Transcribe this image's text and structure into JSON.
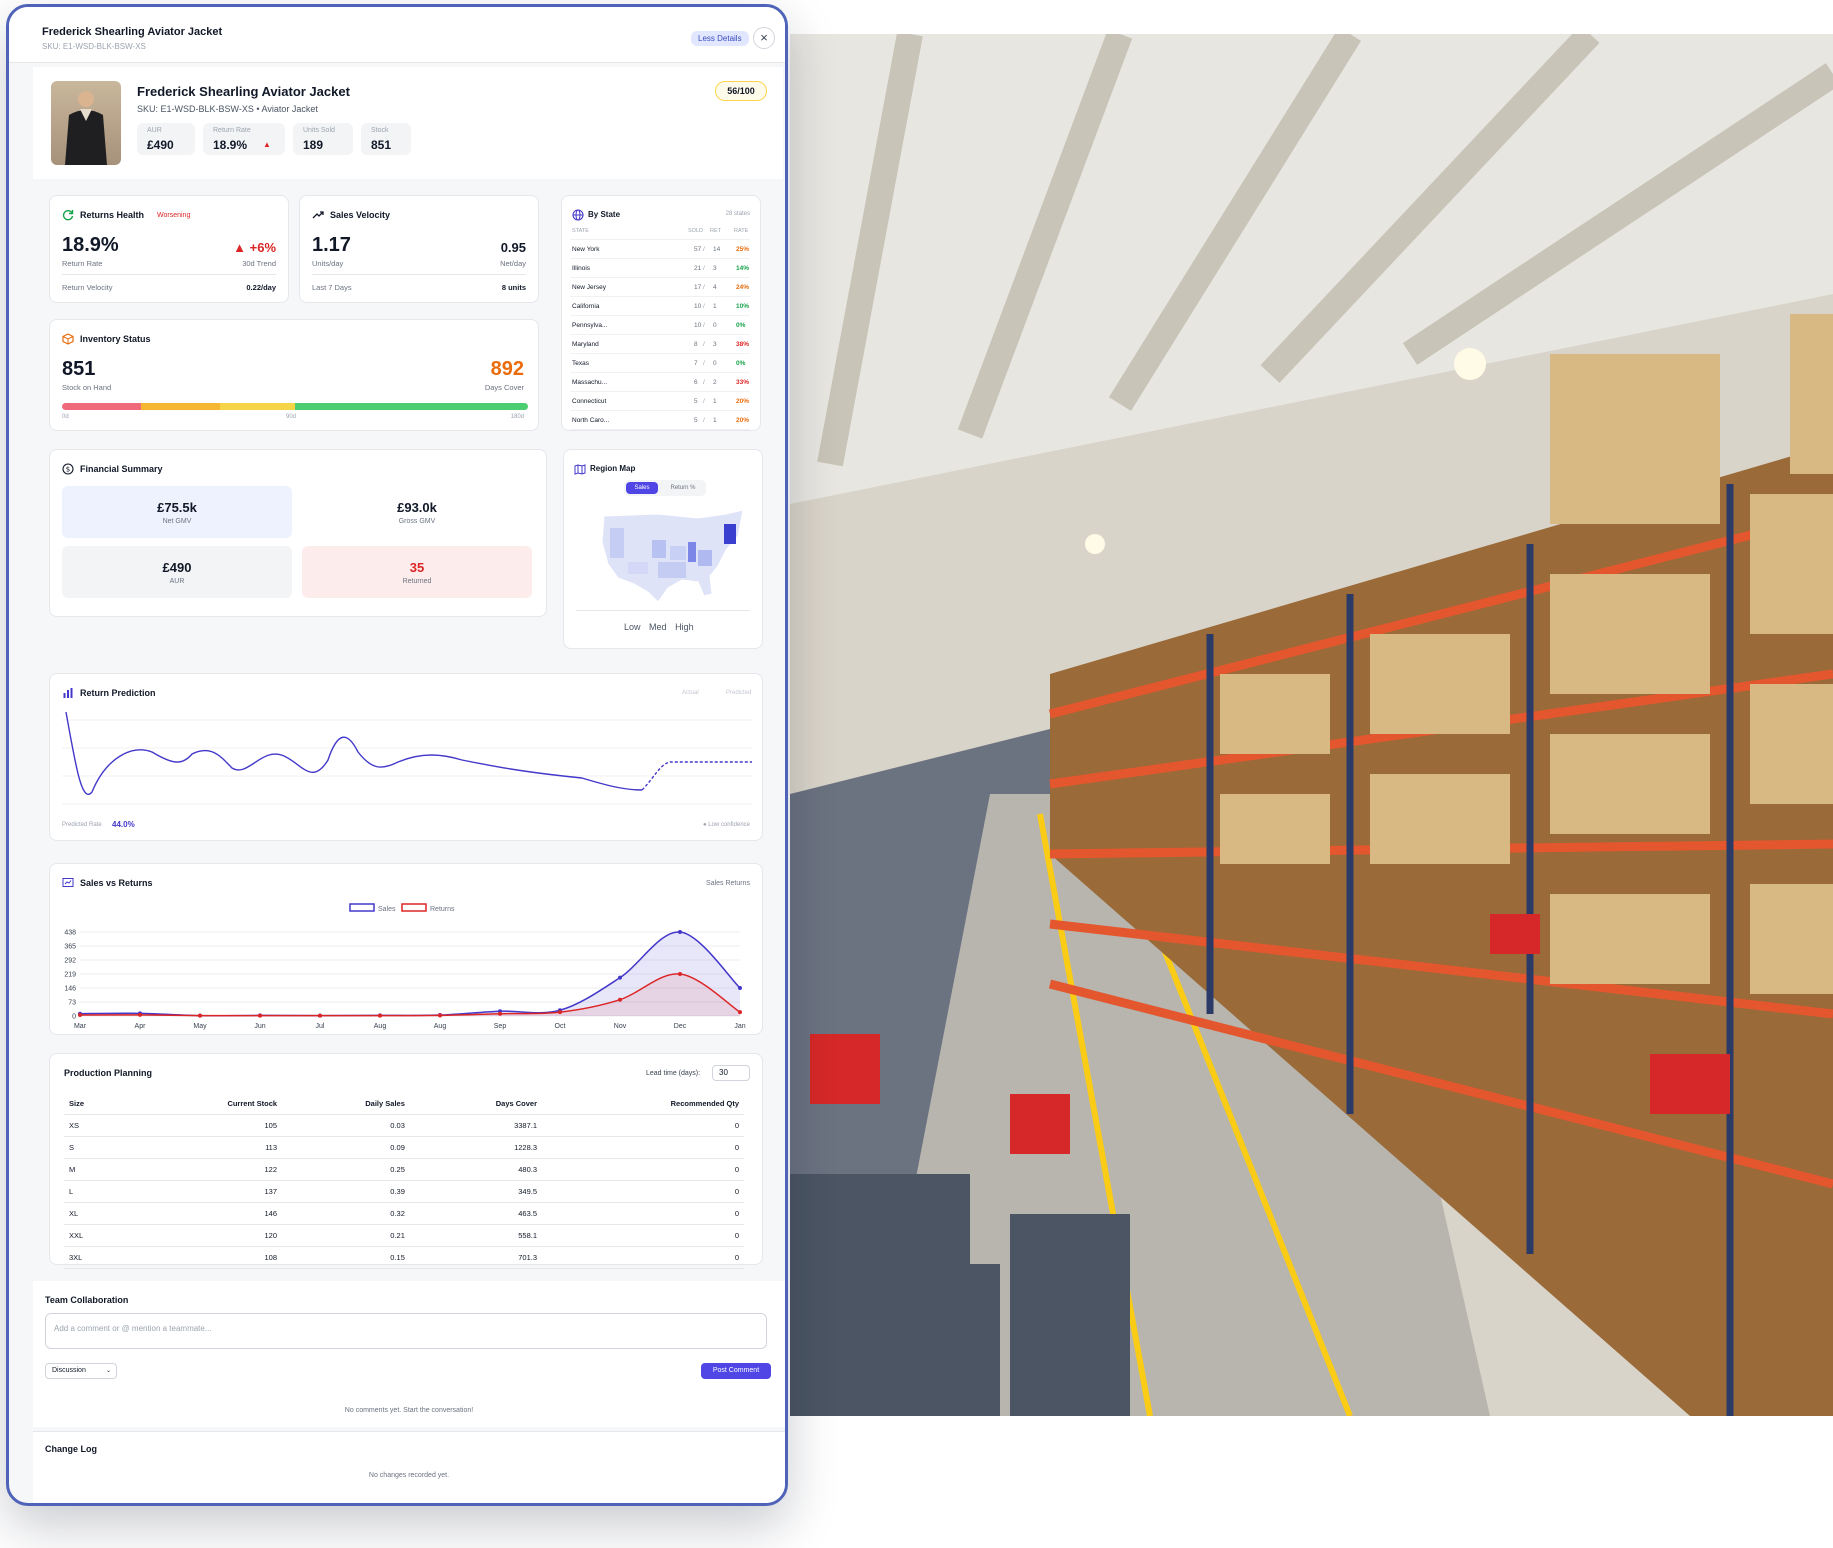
{
  "header": {
    "title": "Frederick Shearling Aviator Jacket",
    "sku": "SKU: E1-WSD-BLK-BSW-XS",
    "less_details": "Less Details",
    "close": "×"
  },
  "product": {
    "title": "Frederick Shearling Aviator Jacket",
    "subtitle": "SKU: E1-WSD-BLK-BSW-XS • Aviator Jacket",
    "score": "56/100",
    "metrics": [
      {
        "label": "AUR",
        "value": "£490"
      },
      {
        "label": "Return Rate",
        "value": "18.9%",
        "arrow": "▲"
      },
      {
        "label": "Units Sold",
        "value": "189"
      },
      {
        "label": "Stock",
        "value": "851"
      }
    ]
  },
  "returns_health": {
    "title": "Returns Health",
    "badge": "Worsening",
    "value": "18.9%",
    "value_label": "Return Rate",
    "trend": "▲ +6%",
    "trend_label": "30d Trend",
    "velocity_label": "Return Velocity",
    "velocity": "0.22/day"
  },
  "sales_velocity": {
    "title": "Sales Velocity",
    "value": "1.17",
    "value_label": "Units/day",
    "net": "0.95",
    "net_label": "Net/day",
    "period_label": "Last 7 Days",
    "units": "8 units"
  },
  "by_state": {
    "title": "By State",
    "count": "28 states",
    "headers": {
      "state": "STATE",
      "sold": "SOLD",
      "ret": "RET",
      "rate": "RATE"
    },
    "rows": [
      {
        "state": "New York",
        "sold": "57",
        "ret": "14",
        "rate": "25%",
        "level": "high"
      },
      {
        "state": "Illinois",
        "sold": "21",
        "ret": "3",
        "rate": "14%",
        "level": "low"
      },
      {
        "state": "New Jersey",
        "sold": "17",
        "ret": "4",
        "rate": "24%",
        "level": "high"
      },
      {
        "state": "California",
        "sold": "10",
        "ret": "1",
        "rate": "10%",
        "level": "low"
      },
      {
        "state": "Pennsylva...",
        "sold": "10",
        "ret": "0",
        "rate": "0%",
        "level": "low"
      },
      {
        "state": "Maryland",
        "sold": "8",
        "ret": "3",
        "rate": "38%",
        "level": "severe"
      },
      {
        "state": "Texas",
        "sold": "7",
        "ret": "0",
        "rate": "0%",
        "level": "low"
      },
      {
        "state": "Massachu...",
        "sold": "6",
        "ret": "2",
        "rate": "33%",
        "level": "severe"
      },
      {
        "state": "Connecticut",
        "sold": "5",
        "ret": "1",
        "rate": "20%",
        "level": "high"
      },
      {
        "state": "North Caro...",
        "sold": "5",
        "ret": "1",
        "rate": "20%",
        "level": "high"
      }
    ]
  },
  "inventory": {
    "title": "Inventory Status",
    "stock": "851",
    "stock_label": "Stock on Hand",
    "days": "892",
    "days_label": "Days Cover",
    "ticks": [
      "0d",
      "90d",
      "180d"
    ]
  },
  "financial": {
    "title": "Financial Summary",
    "items": [
      {
        "value": "£75.5k",
        "label": "Net GMV"
      },
      {
        "value": "£93.0k",
        "label": "Gross GMV"
      },
      {
        "value": "£490",
        "label": "AUR"
      },
      {
        "value": "35",
        "label": "Returned"
      }
    ]
  },
  "region_map": {
    "title": "Region Map",
    "tabs": [
      "Sales",
      "Return %"
    ],
    "legend": [
      "Low",
      "Med",
      "High"
    ]
  },
  "return_prediction": {
    "title": "Return Prediction",
    "legend_actual": "Actual",
    "legend_predicted": "Predicted",
    "predicted_label": "Predicted Rate",
    "predicted_value": "44.0%",
    "confidence": "● Low confidence"
  },
  "chart_data": {
    "type": "area",
    "title": "Sales vs Returns",
    "categories": [
      "Mar",
      "Apr",
      "May",
      "Jun",
      "Jul",
      "Aug",
      "Aug",
      "Sep",
      "Oct",
      "Nov",
      "Dec",
      "Jan"
    ],
    "series": [
      {
        "name": "Sales",
        "values": [
          12,
          14,
          2,
          3,
          2,
          3,
          5,
          25,
          30,
          200,
          438,
          146
        ],
        "color": "#4338ca"
      },
      {
        "name": "Returns",
        "values": [
          5,
          6,
          2,
          2,
          2,
          2,
          3,
          12,
          20,
          85,
          219,
          20
        ],
        "color": "#dc2626"
      }
    ],
    "yticks": [
      0,
      73,
      146,
      219,
      292,
      365,
      438
    ],
    "ylim": [
      0,
      438
    ],
    "grid": true,
    "legend": "top-center",
    "header_legend": "Sales  Returns"
  },
  "production": {
    "title": "Production Planning",
    "lead_label": "Lead time (days):",
    "lead_value": "30",
    "headers": [
      "Size",
      "Current Stock",
      "Daily Sales",
      "Days Cover",
      "Recommended Qty"
    ],
    "rows": [
      [
        "XS",
        "105",
        "0.03",
        "3387.1",
        "0"
      ],
      [
        "S",
        "113",
        "0.09",
        "1228.3",
        "0"
      ],
      [
        "M",
        "122",
        "0.25",
        "480.3",
        "0"
      ],
      [
        "L",
        "137",
        "0.39",
        "349.5",
        "0"
      ],
      [
        "XL",
        "146",
        "0.32",
        "463.5",
        "0"
      ],
      [
        "XXL",
        "120",
        "0.21",
        "558.1",
        "0"
      ],
      [
        "3XL",
        "108",
        "0.15",
        "701.3",
        "0"
      ]
    ]
  },
  "collaboration": {
    "title": "Team Collaboration",
    "placeholder": "Add a comment or @ mention a teammate...",
    "type": "Discussion",
    "post": "Post Comment",
    "empty": "No comments yet. Start the conversation!"
  },
  "changelog": {
    "title": "Change Log",
    "empty": "No changes recorded yet."
  }
}
